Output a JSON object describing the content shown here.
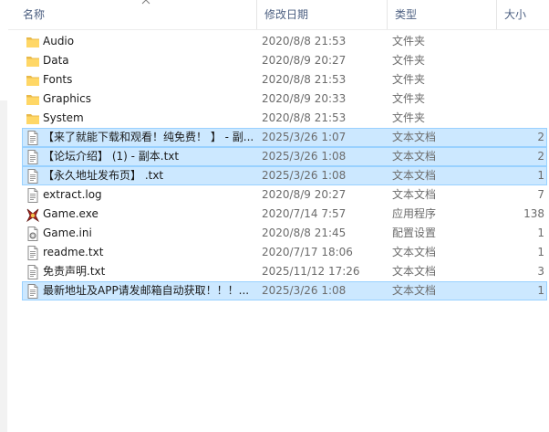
{
  "columns": {
    "name": "名称",
    "modified": "修改日期",
    "type": "类型",
    "size": "大小"
  },
  "sort_indicator_icon": "chevron-up-icon",
  "colors": {
    "header_text": "#4d6082",
    "selected_bg": "#cce8ff",
    "selected_border": "#99d1ff",
    "folder": "#ffd766"
  },
  "files": [
    {
      "name": "Audio",
      "modified": "2020/8/8 21:53",
      "type": "文件夹",
      "size": "",
      "icon": "folder-icon",
      "selected": false
    },
    {
      "name": "Data",
      "modified": "2020/8/9 20:27",
      "type": "文件夹",
      "size": "",
      "icon": "folder-icon",
      "selected": false
    },
    {
      "name": "Fonts",
      "modified": "2020/8/8 21:53",
      "type": "文件夹",
      "size": "",
      "icon": "folder-icon",
      "selected": false
    },
    {
      "name": "Graphics",
      "modified": "2020/8/9 20:33",
      "type": "文件夹",
      "size": "",
      "icon": "folder-icon",
      "selected": false
    },
    {
      "name": "System",
      "modified": "2020/8/8 21:53",
      "type": "文件夹",
      "size": "",
      "icon": "folder-icon",
      "selected": false
    },
    {
      "name": "【来了就能下载和观看！纯免费！ 】 - 副...",
      "modified": "2025/3/26 1:07",
      "type": "文本文档",
      "size": "2",
      "icon": "text-file-icon",
      "selected": true
    },
    {
      "name": "【论坛介绍】 (1) - 副本.txt",
      "modified": "2025/3/26 1:08",
      "type": "文本文档",
      "size": "2",
      "icon": "text-file-icon",
      "selected": true
    },
    {
      "name": "【永久地址发布页】 .txt",
      "modified": "2025/3/26 1:08",
      "type": "文本文档",
      "size": "1",
      "icon": "text-file-icon",
      "selected": true
    },
    {
      "name": "extract.log",
      "modified": "2020/8/9 20:27",
      "type": "文本文档",
      "size": "7",
      "icon": "text-file-icon",
      "selected": false
    },
    {
      "name": "Game.exe",
      "modified": "2020/7/14 7:57",
      "type": "应用程序",
      "size": "138",
      "icon": "game-app-icon",
      "selected": false
    },
    {
      "name": "Game.ini",
      "modified": "2020/8/8 21:45",
      "type": "配置设置",
      "size": "1",
      "icon": "config-file-icon",
      "selected": false
    },
    {
      "name": "readme.txt",
      "modified": "2020/7/17 18:06",
      "type": "文本文档",
      "size": "1",
      "icon": "text-file-icon",
      "selected": false
    },
    {
      "name": "免责声明.txt",
      "modified": "2025/11/12 17:26",
      "type": "文本文档",
      "size": "3",
      "icon": "text-file-icon",
      "selected": false
    },
    {
      "name": "最新地址及APP请发邮箱自动获取！！！...",
      "modified": "2025/3/26 1:08",
      "type": "文本文档",
      "size": "1",
      "icon": "text-file-icon",
      "selected": true
    }
  ]
}
